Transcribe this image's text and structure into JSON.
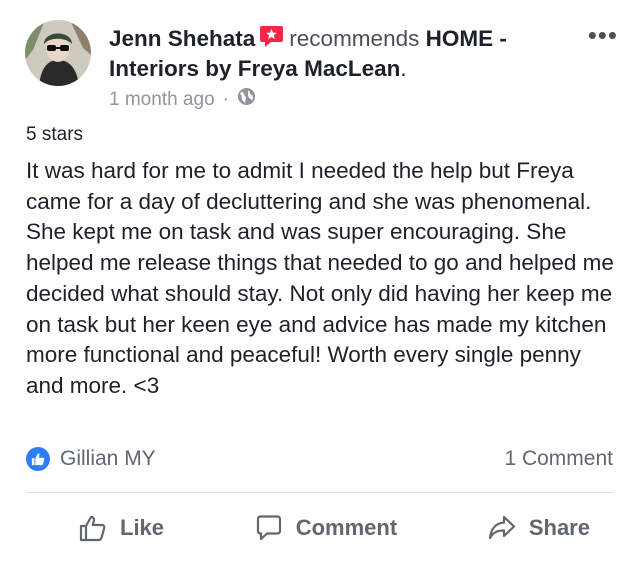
{
  "post": {
    "author": "Jenn Shehata",
    "verb": "recommends",
    "page_name": "HOME - Interiors by Freya MacLean",
    "page_suffix": ".",
    "more_label": "•••",
    "timestamp": "1 month ago",
    "separator": "·",
    "privacy_icon": "globe-icon",
    "rating": "5 stars",
    "review": "It was hard for me to admit I needed the help but Freya came for a day of decluttering and she was phenomenal. She kept me on task and was super encouraging. She helped me release things that needed to go and helped me decided what should stay. Not only did having her keep me on task but her keen eye and advice has made my kitchen more functional and peaceful! Worth every single penny and more. <3"
  },
  "reactions": {
    "icon": "like-icon",
    "names": "Gillian MY",
    "comment_count": "1 Comment"
  },
  "actions": {
    "like": "Like",
    "comment": "Comment",
    "share": "Share"
  },
  "colors": {
    "like_blue": "#2e7cf6",
    "recommend_red": "#f02849",
    "meta_gray": "#90949c",
    "action_gray": "#606770"
  }
}
